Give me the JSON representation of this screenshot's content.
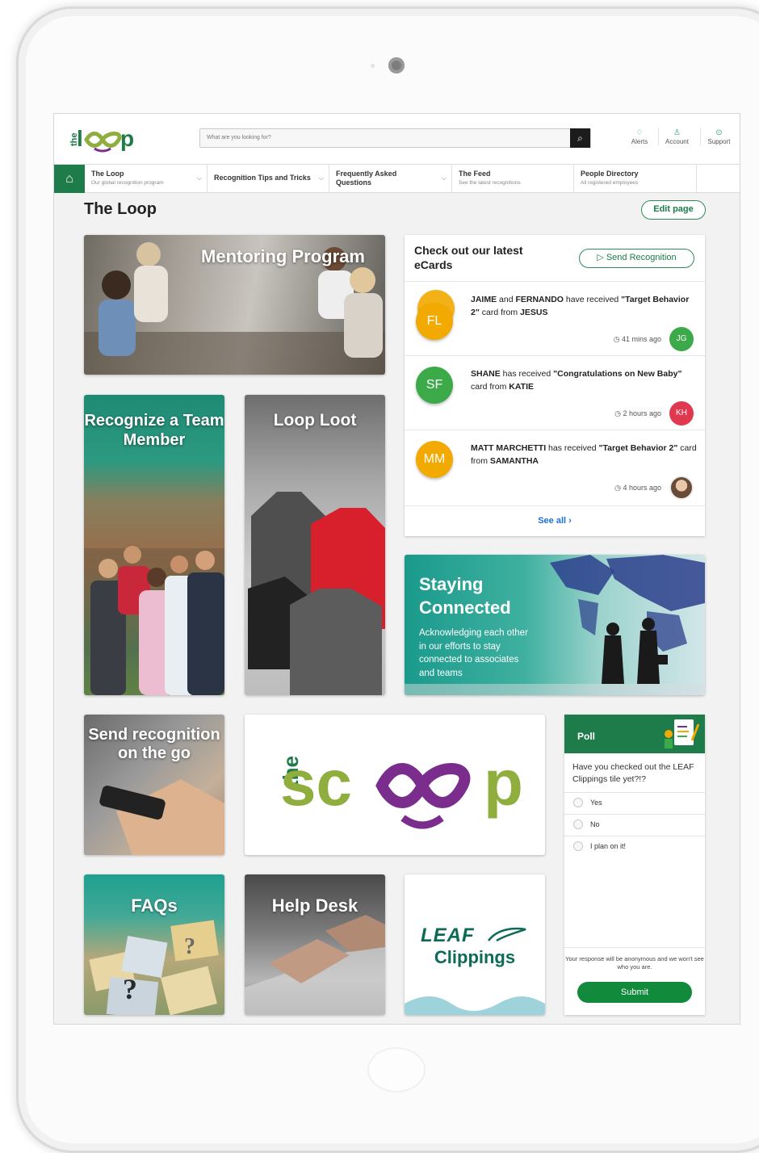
{
  "header": {
    "logo_text": "the loop",
    "search_placeholder": "What are you looking for?",
    "utilities": [
      {
        "label": "Alerts",
        "icon": "bell-icon"
      },
      {
        "label": "Account",
        "icon": "user-icon"
      },
      {
        "label": "Support",
        "icon": "help-icon"
      }
    ]
  },
  "nav": {
    "items": [
      {
        "title": "The Loop",
        "subtitle": "Our global recognition program"
      },
      {
        "title": "Recognition Tips and Tricks",
        "subtitle": ""
      },
      {
        "title": "Frequently Asked Questions",
        "subtitle": ""
      },
      {
        "title": "The Feed",
        "subtitle": "See the latest recognitions"
      },
      {
        "title": "People Directory",
        "subtitle": "All registered employees"
      }
    ]
  },
  "page": {
    "title": "The Loop",
    "edit_label": "Edit page"
  },
  "tiles": {
    "mentoring": "Mentoring Program",
    "recognize": "Recognize a Team Member",
    "loot": "Loop Loot",
    "staying_title": "Staying Connected",
    "staying_text": "Acknowledging each other in our efforts to stay connected to associates and teams",
    "send_go": "Send recognition on the go",
    "scoop": "thescoop",
    "faqs": "FAQs",
    "helpdesk": "Help Desk",
    "leaf_brand": "LEAF",
    "leaf_clippings": "Clippings"
  },
  "ecards": {
    "title": "Check out our latest eCards",
    "send_label": "Send Recognition",
    "see_all": "See all ›",
    "items": [
      {
        "avatar": "FL",
        "avatar_color": "#f2a900",
        "text_html": "<b>JAIME</b> and <b>FERNANDO</b> have received <b>\"Target Behavior 2\"</b> card from <b>JESUS</b>",
        "time": "41 mins ago",
        "sender": "JG",
        "sender_color": "#3daa4a"
      },
      {
        "avatar": "SF",
        "avatar_color": "#3daa4a",
        "text_html": "<b>SHANE</b> has received <b>\"Congratulations on New Baby\"</b> card from <b>KATIE</b>",
        "time": "2 hours ago",
        "sender": "KH",
        "sender_color": "#e0384f"
      },
      {
        "avatar": "MM",
        "avatar_color": "#f2a900",
        "text_html": "<b>MATT MARCHETTI</b> has received <b>\"Target Behavior 2\"</b> card from <b>SAMANTHA</b>",
        "time": "4 hours ago",
        "sender": "",
        "sender_color": "#8a6a55"
      }
    ]
  },
  "poll": {
    "title": "Poll",
    "question": "Have you checked out the LEAF Clippings tile yet?!?",
    "options": [
      "Yes",
      "No",
      "I plan on it!"
    ],
    "note": "Your response will be anonymous and we won't see who you are.",
    "submit": "Submit"
  },
  "colors": {
    "brand_green": "#1e7b4a",
    "accent_purple": "#7b2d8e",
    "scoop_green": "#8fae3d",
    "link_blue": "#1e6fd9"
  }
}
